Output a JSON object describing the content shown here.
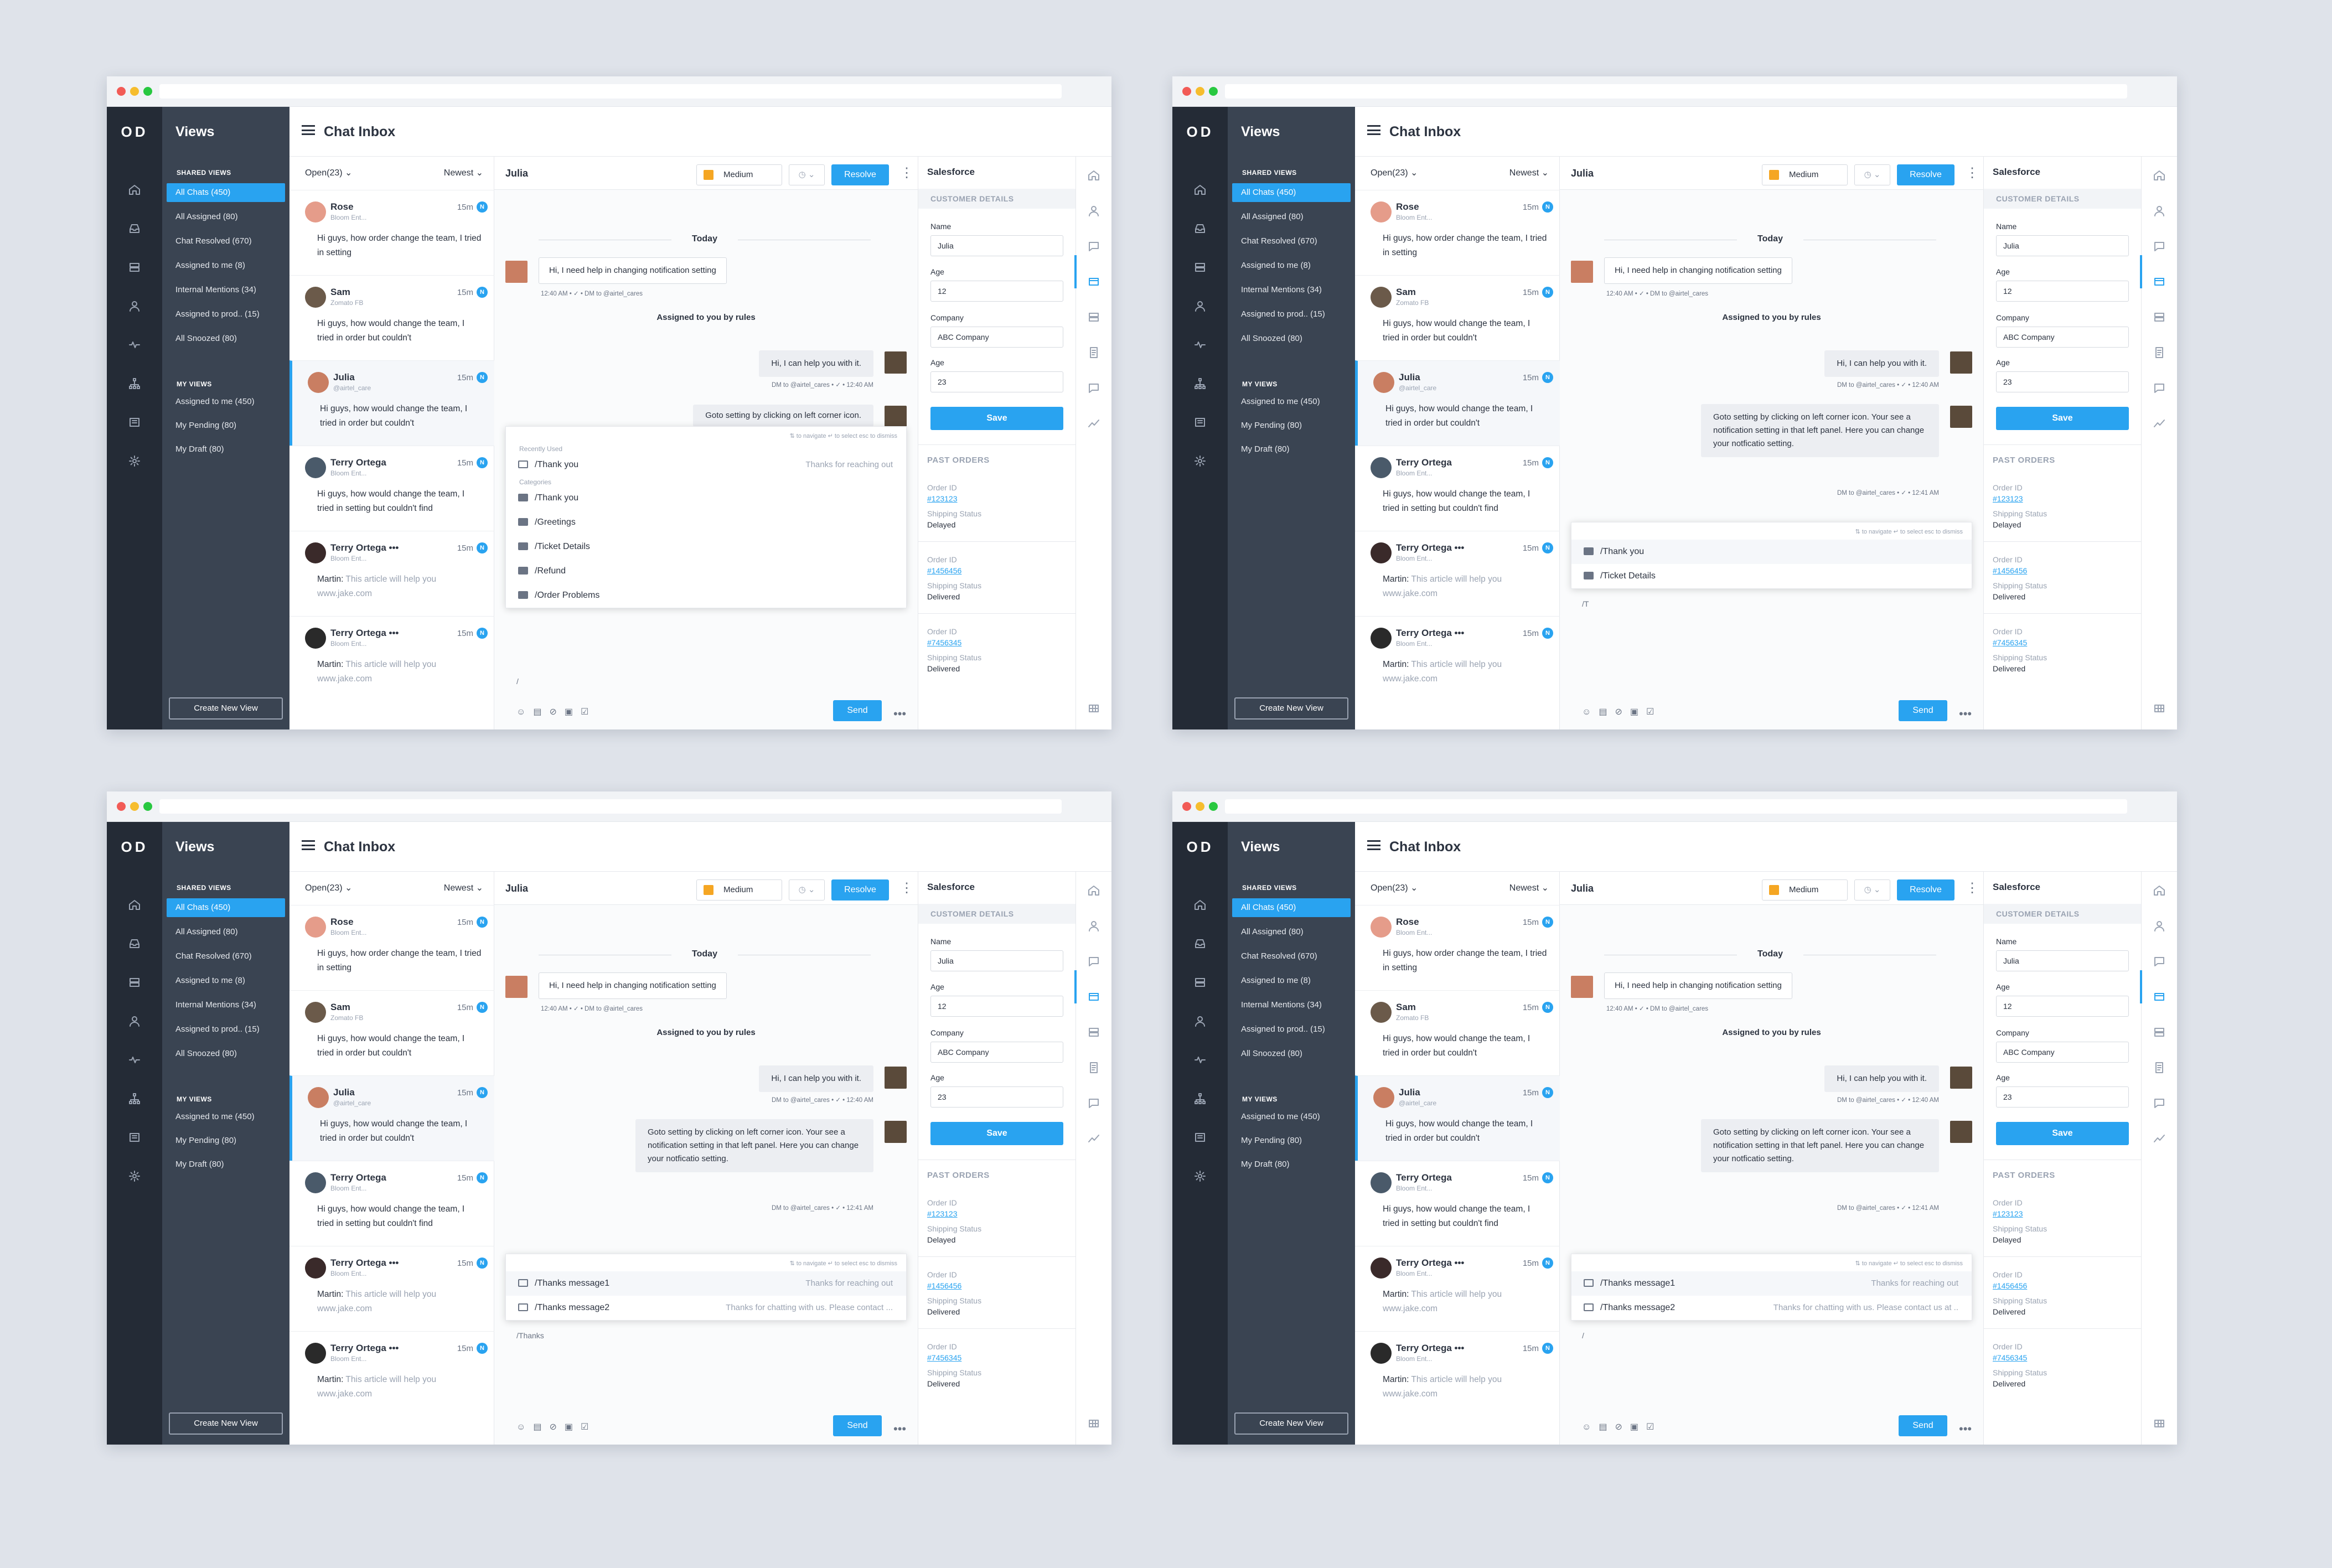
{
  "brand": {
    "logo": "OD"
  },
  "views": {
    "title": "Views",
    "shared_label": "SHARED VIEWS",
    "shared": [
      "All Chats (450)",
      "All Assigned  (80)",
      "Chat Resolved  (670)",
      "Assigned to me  (8)",
      "Internal Mentions  (34)",
      "Assigned to prod..  (15)",
      "All Snoozed  (80)"
    ],
    "my_label": "MY VIEWS",
    "mine": [
      "Assigned to me  (450)",
      "My Pending  (80)",
      "My Draft  (80)"
    ],
    "create_button": "Create New View"
  },
  "header": {
    "title": "Chat Inbox"
  },
  "list": {
    "filter": "Open(23) ⌄",
    "sort": "Newest ⌄",
    "chats": [
      {
        "name": "Rose",
        "source": "Bloom Ent...",
        "time": "15m",
        "badge": "N",
        "msg": "Hi guys, how order change the team, I tried in setting",
        "gray": ""
      },
      {
        "name": "Sam",
        "source": "Zomato FB",
        "time": "15m",
        "badge": "N",
        "msg": "Hi guys, how would change the team, I tried in order but couldn't",
        "gray": ""
      },
      {
        "name": "Julia",
        "source": "@airtel_care",
        "time": "15m",
        "badge": "N",
        "msg": "Hi guys, how would change the team, I tried in order but couldn't",
        "gray": ""
      },
      {
        "name": "Terry Ortega",
        "source": "Bloom Ent...",
        "time": "15m",
        "badge": "N",
        "msg": "Hi guys, how would change the team, I tried in setting but couldn't find",
        "gray": ""
      },
      {
        "name": "Terry Ortega  •••",
        "source": "Bloom Ent...",
        "time": "15m",
        "badge": "N",
        "msg": "Martin: ",
        "gray": "This article will help you www.jake.com"
      },
      {
        "name": "Terry Ortega  •••",
        "source": "Bloom Ent...",
        "time": "15m",
        "badge": "N",
        "msg": "Martin: ",
        "gray": "This article will help you www.jake.com"
      }
    ]
  },
  "conversation": {
    "name": "Julia",
    "priority": "Medium",
    "resolve": "Resolve",
    "day": "Today",
    "in1": "Hi, I need help in changing notification setting",
    "in1_meta": "12:40 AM  •  ✓  •  DM to @airtel_cares",
    "rules": "Assigned to you by rules",
    "out1": "Hi, I can help you with it.",
    "out_meta": "DM to @airtel_cares  •  ✓  •  12:40 AM",
    "out2": "Goto setting by clicking on left corner icon. Your see a notification setting in that left panel. Here you can change your notficatio setting.",
    "out2_short": "Goto setting by clicking on left corner icon.",
    "out2_meta": "DM to @airtel_cares  •  ✓  •  12:41 AM",
    "popup_nav": "⇅ to navigate   ↵ to select   esc to dismiss",
    "recent_label": "Recently Used",
    "cat_label": "Categories",
    "send": "Send",
    "w1": {
      "recent": "/Thank you",
      "recent_hint": "Thanks for reaching out",
      "cats": [
        "/Thank you",
        "/Greetings",
        "/Ticket Details",
        "/Refund",
        "/Order Problems"
      ],
      "typed": "/"
    },
    "w2": {
      "items": [
        "/Thank you",
        "/Ticket Details"
      ],
      "typed": "/T"
    },
    "w3": {
      "items": [
        "/Thanks message1",
        "/Thanks message2"
      ],
      "hints": [
        "Thanks for reaching out",
        "Thanks for chatting with us. Please contact ..."
      ],
      "typed": "/Thanks"
    },
    "w4": {
      "items": [
        "/Thanks message1",
        "/Thanks message2"
      ],
      "hints": [
        "Thanks for reaching out",
        "Thanks for chatting with us. Please contact us at .."
      ],
      "typed": "/"
    }
  },
  "salesforce": {
    "title": "Salesforce",
    "section": "CUSTOMER DETAILS",
    "fields": [
      {
        "label": "Name",
        "value": "Julia"
      },
      {
        "label": "Age",
        "value": "12"
      },
      {
        "label": "Company",
        "value": "ABC Company"
      },
      {
        "label": "Age",
        "value": "23"
      }
    ],
    "save": "Save",
    "past_orders": "PAST ORDERS",
    "order_label": "Order ID",
    "status_label": "Shipping Status",
    "orders": [
      {
        "id": "#123123",
        "status": "Delayed"
      },
      {
        "id": "#1456456",
        "status": "Delivered"
      },
      {
        "id": "#7456345",
        "status": "Delivered"
      }
    ]
  },
  "colors": {
    "accent": "#29a3f0",
    "rail": "#242b36",
    "views_panel": "#3a4452",
    "priority": "#f5a623"
  }
}
